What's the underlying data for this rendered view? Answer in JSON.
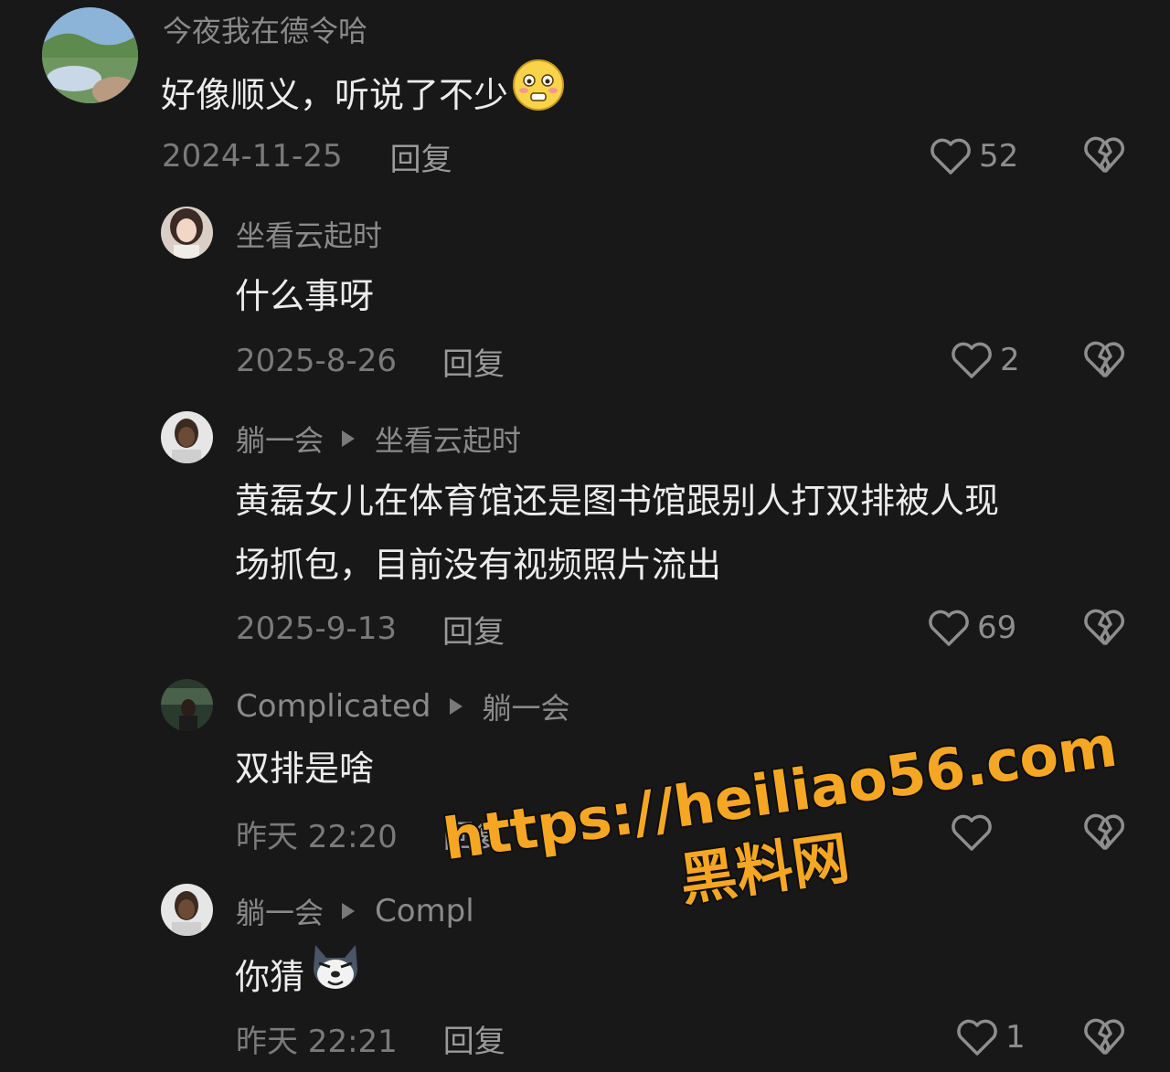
{
  "comments": [
    {
      "username": "今夜我在德令哈",
      "reply_to": "",
      "text": "好像顺义，听说了不少",
      "emoji": "flushed-face-emoji",
      "date": "2024-11-25",
      "reply_label": "回复",
      "likes": "52"
    },
    {
      "username": "坐看云起时",
      "reply_to": "",
      "text": "什么事呀",
      "date": "2025-8-26",
      "reply_label": "回复",
      "likes": "2"
    },
    {
      "username": "躺一会",
      "reply_to": "坐看云起时",
      "text_line1": "黄磊女儿在体育馆还是图书馆跟别人打双排被人现",
      "text_line2": "场抓包，目前没有视频照片流出",
      "date": "2025-9-13",
      "reply_label": "回复",
      "likes": "69"
    },
    {
      "username": "Complicated",
      "reply_to": "躺一会",
      "text": "双排是啥",
      "date": "昨天 22:20",
      "reply_label": "回复",
      "likes": ""
    },
    {
      "username": "躺一会",
      "reply_to": "Compl",
      "text": "你猜",
      "emoji": "husky-face-emoji",
      "date": "昨天 22:21",
      "reply_label": "回复",
      "likes": "1"
    }
  ],
  "watermark": {
    "line1": "https://heiliao56.com",
    "line2": "黑料网",
    "color": "#f5a623"
  },
  "colors": {
    "background": "#181818",
    "text": "#ececec",
    "muted": "#8a8a8a"
  },
  "icons": {
    "like": "heart-outline-icon",
    "dislike": "broken-heart-icon"
  }
}
